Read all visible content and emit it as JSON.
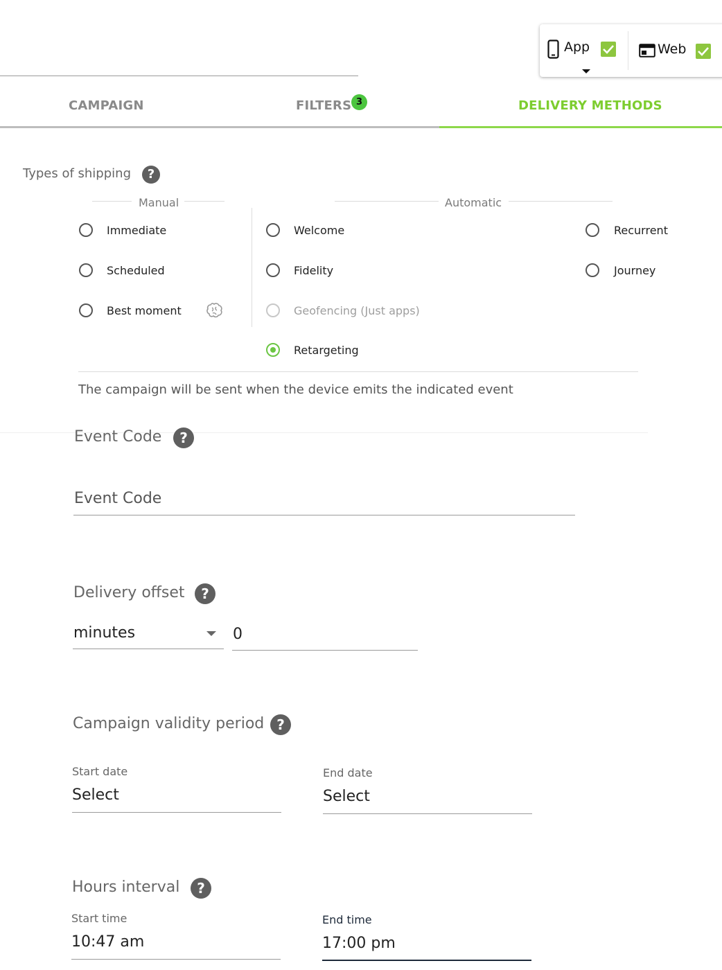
{
  "platforms": {
    "app_label": "App",
    "web_label": "Web"
  },
  "tabs": [
    {
      "label": "CAMPAIGN"
    },
    {
      "label": "FILTERS",
      "badge": "3"
    },
    {
      "label": "DELIVERY METHODS"
    }
  ],
  "shipping": {
    "title": "Types of shipping",
    "manual_label": "Manual",
    "automatic_label": "Automatic",
    "options": {
      "immediate": "Immediate",
      "scheduled": "Scheduled",
      "best_moment": "Best moment",
      "welcome": "Welcome",
      "fidelity": "Fidelity",
      "geofencing": "Geofencing (Just apps)",
      "retargeting": "Retargeting",
      "recurrent": "Recurrent",
      "journey": "Journey"
    },
    "selected": "Retargeting",
    "description": "The campaign will be sent when the device emits the indicated event"
  },
  "event_code": {
    "title": "Event Code",
    "placeholder": "Event Code"
  },
  "delivery_offset": {
    "title": "Delivery offset",
    "unit": "minutes",
    "value": "0"
  },
  "validity": {
    "title": "Campaign validity period",
    "start_label": "Start date",
    "start_value": "Select",
    "end_label": "End date",
    "end_value": "Select"
  },
  "hours": {
    "title": "Hours interval",
    "start_label": "Start time",
    "start_value": "10:47 am",
    "end_label": "End time",
    "end_value": "17:00 pm"
  },
  "help_glyph": "?",
  "colors": {
    "accent": "#7dcd2f",
    "check": "#8dc63f",
    "badge": "#4cc53f"
  }
}
